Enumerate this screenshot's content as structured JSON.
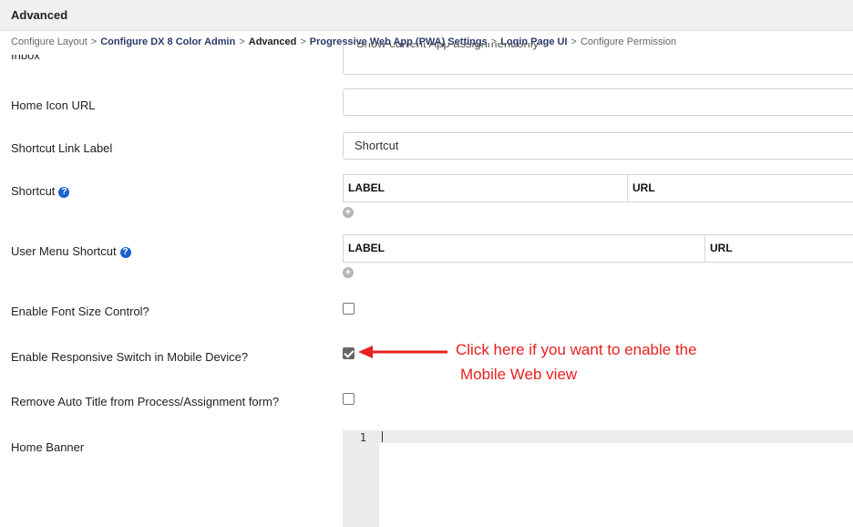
{
  "header": {
    "title": "Advanced"
  },
  "breadcrumb": {
    "items": [
      "Configure Layout",
      "Configure DX 8 Color Admin",
      "Advanced",
      "Progressive Web App (PWA) Settings",
      "Login Page UI",
      "Configure Permission"
    ],
    "separator": ">"
  },
  "form": {
    "inbox": {
      "label": "Inbox",
      "value": "Show current App assignment only"
    },
    "home_icon_url": {
      "label": "Home Icon URL",
      "value": ""
    },
    "shortcut_link_label": {
      "label": "Shortcut Link Label",
      "value": "Shortcut"
    },
    "shortcut": {
      "label": "Shortcut",
      "columns": [
        "LABEL",
        "URL"
      ]
    },
    "user_menu_shortcut": {
      "label": "User Menu Shortcut",
      "columns": [
        "LABEL",
        "URL"
      ]
    },
    "enable_font_size_control": {
      "label": "Enable Font Size Control?",
      "checked": false
    },
    "enable_responsive_switch": {
      "label": "Enable Responsive Switch in Mobile Device?",
      "checked": true
    },
    "remove_auto_title": {
      "label": "Remove Auto Title from Process/Assignment form?",
      "checked": false
    },
    "home_banner": {
      "label": "Home Banner",
      "line_number": "1"
    }
  },
  "annotation": {
    "line1": "Click here if you want to enable the",
    "line2": "Mobile Web view",
    "color": "#e8201f"
  },
  "icons": {
    "help": "question-circle-icon",
    "add": "plus-circle-icon"
  }
}
